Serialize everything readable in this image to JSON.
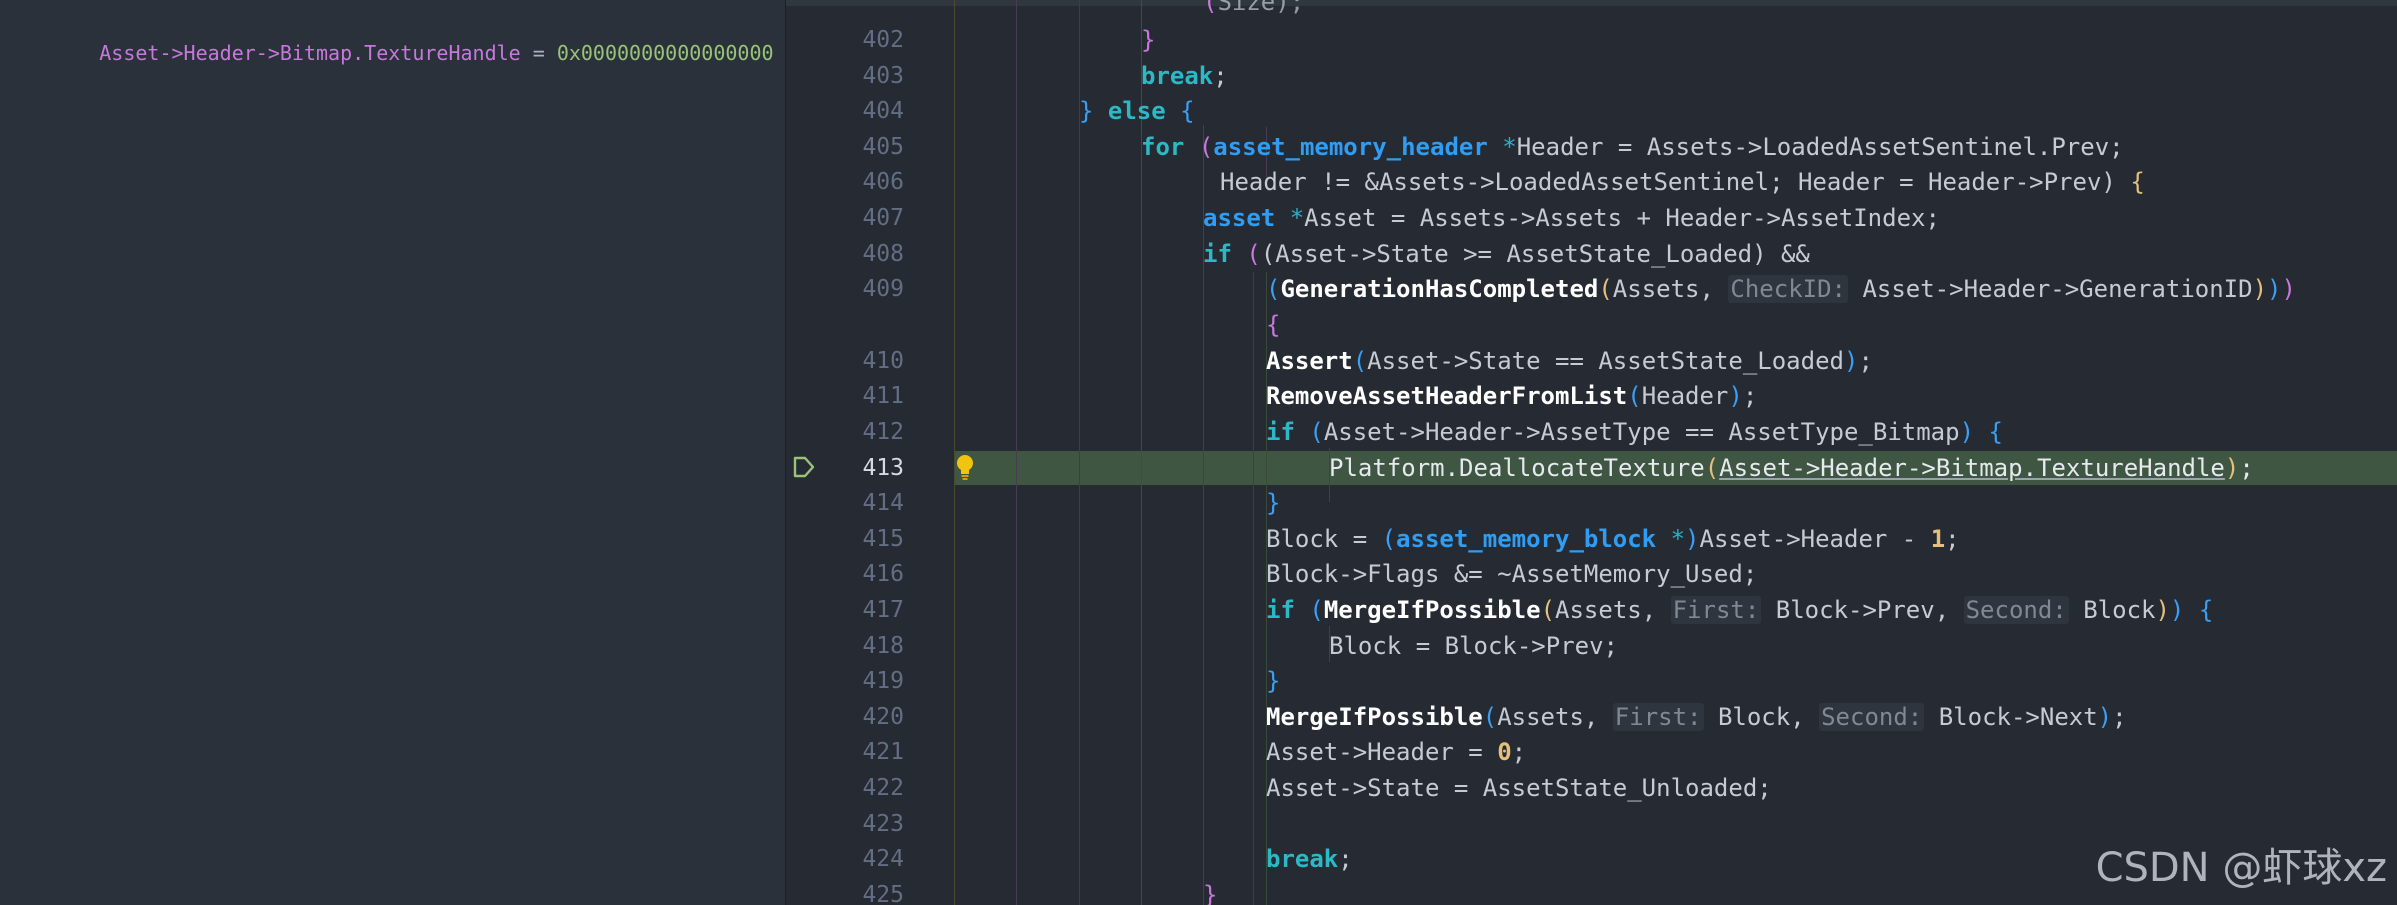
{
  "watch": {
    "expression": "Asset->Header->Bitmap.TextureHandle",
    "equals": " = ",
    "value": "0x0000000000000000"
  },
  "editor": {
    "current_line": "413",
    "line_numbers": [
      "402",
      "403",
      "404",
      "405",
      "406",
      "407",
      "408",
      "409",
      "",
      "410",
      "411",
      "412",
      "413",
      "414",
      "415",
      "416",
      "417",
      "418",
      "419",
      "420",
      "421",
      "422",
      "423",
      "424",
      "425"
    ],
    "code": {
      "top_partial": "Size);",
      "kw_break": "break",
      "kw_else": "else",
      "kw_for": "for",
      "kw_if": "if",
      "type_header": "asset_memory_header",
      "type_asset": "asset",
      "type_block": "asset_memory_block",
      "l405_rest": "Header = Assets->LoadedAssetSentinel.Prev;",
      "l406": "Header != &Assets->LoadedAssetSentinel; Header = Header->Prev)",
      "l407_rest": "Asset = Assets->Assets + Header->AssetIndex;",
      "l408_rest": "(Asset->State >= AssetState_Loaded) &&",
      "fn_gen": "GenerationHasCompleted",
      "l409_a": "Assets, ",
      "hint_checkid": "CheckID:",
      "l409_b": "Asset->Header->GenerationID",
      "fn_assert": "Assert",
      "l410_args": "Asset->State == AssetState_Loaded",
      "fn_remove": "RemoveAssetHeaderFromList",
      "l411_args": "Header",
      "l412_rest": "Asset->Header->AssetType == AssetType_Bitmap",
      "l413_call": "Platform.DeallocateTexture",
      "l413_args": "Asset->Header->Bitmap.TextureHandle",
      "l415_a": "Block = ",
      "l415_b": "Asset->Header - ",
      "num_one": "1",
      "l416": "Block->Flags &= ~AssetMemory_Used;",
      "fn_merge": "MergeIfPossible",
      "hint_first": "First:",
      "hint_second": "Second:",
      "l417_a": "Assets, ",
      "l417_b": "Block->Prev, ",
      "l417_c": "Block",
      "l418": "Block = Block->Prev;",
      "l420_a": "Assets, ",
      "l420_b": "Block, ",
      "l420_c": "Block->Next",
      "l421_a": "Asset->Header = ",
      "num_zero": "0",
      "l422": "Asset->State = AssetState_Unloaded;"
    }
  },
  "watermark": "CSDN @虾球xz",
  "icons": {
    "breakpoint": "current-line-arrow-icon",
    "hint": "lightbulb-icon"
  },
  "colors": {
    "background": "#262b33",
    "highlight": "#3f5643",
    "keyword": "#3a9ff5",
    "watch_expression": "#c678dd",
    "watch_value": "#98c379"
  }
}
